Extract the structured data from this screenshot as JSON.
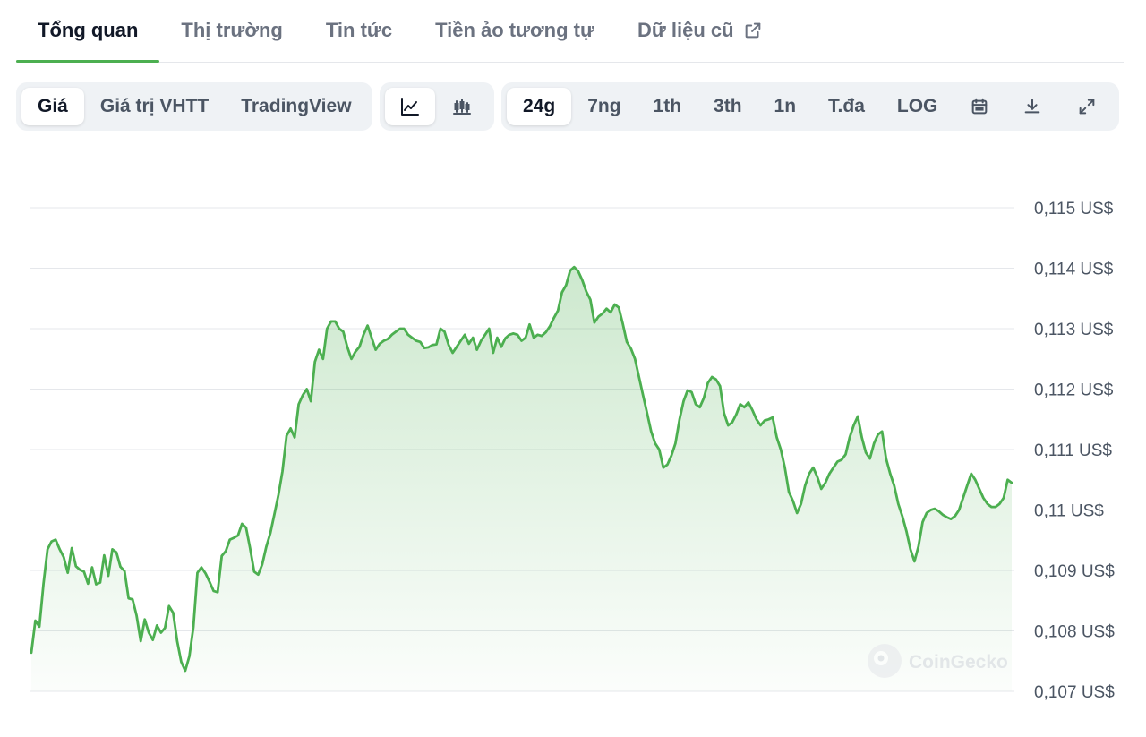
{
  "tabs": [
    {
      "label": "Tổng quan",
      "active": true
    },
    {
      "label": "Thị trường",
      "active": false
    },
    {
      "label": "Tin tức",
      "active": false
    },
    {
      "label": "Tiền ảo tương tự",
      "active": false
    },
    {
      "label": "Dữ liệu cũ",
      "active": false,
      "icon": "external-link-icon"
    }
  ],
  "toolbar": {
    "data_types": [
      {
        "label": "Giá",
        "active": true
      },
      {
        "label": "Giá trị VHTT",
        "active": false
      },
      {
        "label": "TradingView",
        "active": false
      }
    ],
    "chart_styles": [
      {
        "icon": "line-chart-icon",
        "active": true
      },
      {
        "icon": "candlestick-chart-icon",
        "active": false
      }
    ],
    "ranges": [
      {
        "label": "24g",
        "active": true
      },
      {
        "label": "7ng",
        "active": false
      },
      {
        "label": "1th",
        "active": false
      },
      {
        "label": "3th",
        "active": false
      },
      {
        "label": "1n",
        "active": false
      },
      {
        "label": "T.đa",
        "active": false
      },
      {
        "label": "LOG",
        "active": false
      }
    ],
    "actions": [
      {
        "icon": "calendar-icon"
      },
      {
        "icon": "download-icon"
      },
      {
        "icon": "fullscreen-icon"
      }
    ]
  },
  "watermark": "CoinGecko",
  "colors": {
    "line": "#4caf50",
    "accent": "#4caf50",
    "grid": "#e5e7eb",
    "tick_text": "#4b5563"
  },
  "chart_data": {
    "type": "area",
    "title": "",
    "xlabel": "",
    "ylabel": "",
    "ylim": [
      0.107,
      0.115
    ],
    "yticks": [
      0.115,
      0.114,
      0.113,
      0.112,
      0.111,
      0.11,
      0.109,
      0.108,
      0.107
    ],
    "ytick_labels": [
      "0,115 US$",
      "0,114 US$",
      "0,113 US$",
      "0,112 US$",
      "0,111 US$",
      "0,11 US$",
      "0,109 US$",
      "0,108 US$",
      "0,107 US$"
    ],
    "grid": true,
    "x_axis_visible": false,
    "series": [
      {
        "values": [
          0.10764,
          0.10817,
          0.10807,
          0.10878,
          0.10935,
          0.10948,
          0.10951,
          0.10935,
          0.10922,
          0.10896,
          0.10937,
          0.10907,
          0.10901,
          0.10898,
          0.10878,
          0.10905,
          0.10877,
          0.1088,
          0.10925,
          0.10891,
          0.10935,
          0.1093,
          0.10906,
          0.10899,
          0.10854,
          0.10852,
          0.10825,
          0.10783,
          0.10819,
          0.10797,
          0.10785,
          0.10809,
          0.10797,
          0.10805,
          0.10841,
          0.1083,
          0.10783,
          0.10749,
          0.10734,
          0.10758,
          0.10806,
          0.10896,
          0.10905,
          0.10895,
          0.10881,
          0.10866,
          0.10864,
          0.10924,
          0.10932,
          0.10951,
          0.10954,
          0.10958,
          0.10977,
          0.10971,
          0.10937,
          0.10898,
          0.10893,
          0.1091,
          0.10939,
          0.10962,
          0.10993,
          0.11025,
          0.11064,
          0.11123,
          0.11135,
          0.1112,
          0.11175,
          0.1119,
          0.112,
          0.1118,
          0.11245,
          0.11265,
          0.1125,
          0.113,
          0.11312,
          0.11312,
          0.113,
          0.11295,
          0.1127,
          0.1125,
          0.11262,
          0.1127,
          0.1129,
          0.11305,
          0.11285,
          0.11265,
          0.11275,
          0.1128,
          0.11283,
          0.1129,
          0.11295,
          0.113,
          0.113,
          0.1129,
          0.11285,
          0.1128,
          0.11278,
          0.11268,
          0.11269,
          0.11273,
          0.11274,
          0.113,
          0.11295,
          0.11273,
          0.1126,
          0.1127,
          0.1128,
          0.1129,
          0.11275,
          0.11285,
          0.11265,
          0.1128,
          0.1129,
          0.113,
          0.1126,
          0.11285,
          0.1127,
          0.11284,
          0.1129,
          0.11292,
          0.1129,
          0.1128,
          0.11285,
          0.11307,
          0.11285,
          0.1129,
          0.11288,
          0.11294,
          0.11304,
          0.11318,
          0.1133,
          0.1136,
          0.11372,
          0.11396,
          0.11402,
          0.11395,
          0.1138,
          0.11361,
          0.11348,
          0.1131,
          0.1132,
          0.11325,
          0.11333,
          0.11327,
          0.1134,
          0.11335,
          0.11308,
          0.11278,
          0.11267,
          0.1125,
          0.1122,
          0.1119,
          0.1116,
          0.1113,
          0.1111,
          0.111,
          0.1107,
          0.11075,
          0.1109,
          0.1111,
          0.1115,
          0.1118,
          0.11198,
          0.11195,
          0.11175,
          0.1117,
          0.11185,
          0.1121,
          0.1122,
          0.11216,
          0.11205,
          0.1116,
          0.1114,
          0.11145,
          0.11158,
          0.11175,
          0.1117,
          0.11178,
          0.11165,
          0.1115,
          0.1114,
          0.11148,
          0.1115,
          0.11153,
          0.1112,
          0.111,
          0.1107,
          0.1103,
          0.11015,
          0.10995,
          0.1101,
          0.1104,
          0.1106,
          0.1107,
          0.11055,
          0.11035,
          0.11045,
          0.1106,
          0.1107,
          0.1108,
          0.11083,
          0.11092,
          0.1112,
          0.1114,
          0.11155,
          0.1112,
          0.11095,
          0.11085,
          0.1111,
          0.11125,
          0.1113,
          0.11085,
          0.1106,
          0.1104,
          0.1101,
          0.1099,
          0.10965,
          0.10935,
          0.10915,
          0.1094,
          0.1098,
          0.10995,
          0.11,
          0.11002,
          0.10998,
          0.10992,
          0.10988,
          0.10985,
          0.1099,
          0.11,
          0.1102,
          0.1104,
          0.1106,
          0.1105,
          0.11035,
          0.1102,
          0.1101,
          0.11005,
          0.11005,
          0.1101,
          0.1102,
          0.1105,
          0.11045
        ]
      }
    ]
  }
}
